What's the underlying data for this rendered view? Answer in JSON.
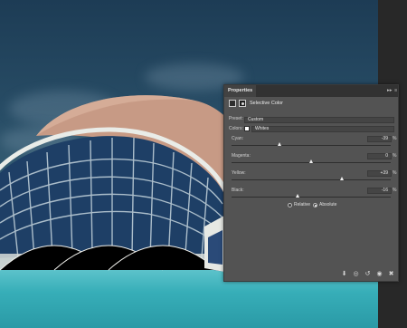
{
  "panel": {
    "tab_label": "Properties",
    "collapse_glyph": "▸▸",
    "menu_glyph": "≡",
    "adjustment_title": "Selective Color",
    "preset_label": "Preset:",
    "preset_value": "Custom",
    "colors_label": "Colors:",
    "colors_value": "Whites",
    "swatch_color": "#ffffff",
    "caret": "⌵",
    "sliders": [
      {
        "name": "Cyan:",
        "value": "-39",
        "unit": "%",
        "level": -39
      },
      {
        "name": "Magenta:",
        "value": "0",
        "unit": "%",
        "level": 0
      },
      {
        "name": "Yellow:",
        "value": "+39",
        "unit": "%",
        "level": 39
      },
      {
        "name": "Black:",
        "value": "-16",
        "unit": "%",
        "level": -16
      }
    ],
    "method": {
      "relative_label": "Relative",
      "absolute_label": "Absolute",
      "selected": "Absolute"
    },
    "bottom_icons": [
      "clip-to-layer-icon",
      "view-previous-state-icon",
      "reset-icon",
      "toggle-visibility-icon",
      "delete-icon"
    ]
  }
}
